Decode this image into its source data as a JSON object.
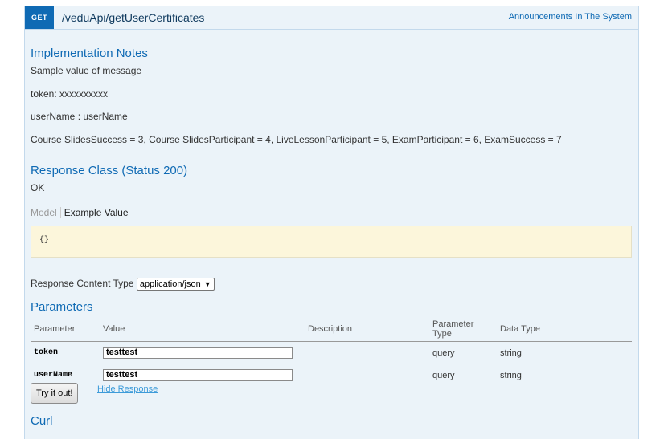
{
  "operation": {
    "method": "GET",
    "path": "/veduApi/getUserCertificates",
    "tag_link": "Announcements In The System"
  },
  "implementation_notes": {
    "heading": "Implementation Notes",
    "lines": [
      "Sample value of message",
      "token: xxxxxxxxxx",
      "userName : userName",
      "Course SlidesSuccess = 3, Course SlidesParticipant = 4, LiveLessonParticipant = 5, ExamParticipant = 6, ExamSuccess = 7"
    ]
  },
  "response_class": {
    "heading": "Response Class (Status 200)",
    "status_text": "OK",
    "tab_model": "Model",
    "tab_example": "Example Value",
    "example_value": "{}"
  },
  "content_type": {
    "label": "Response Content Type",
    "selected": "application/json"
  },
  "parameters": {
    "heading": "Parameters",
    "columns": [
      "Parameter",
      "Value",
      "Description",
      "Parameter Type",
      "Data Type"
    ],
    "rows": [
      {
        "name": "token",
        "value": "testtest",
        "description": "",
        "param_type": "query",
        "data_type": "string"
      },
      {
        "name": "userName",
        "value": "testtest",
        "description": "",
        "param_type": "query",
        "data_type": "string"
      }
    ]
  },
  "actions": {
    "try_label": "Try it out!",
    "hide_response": "Hide Response"
  },
  "curl": {
    "heading": "Curl"
  }
}
